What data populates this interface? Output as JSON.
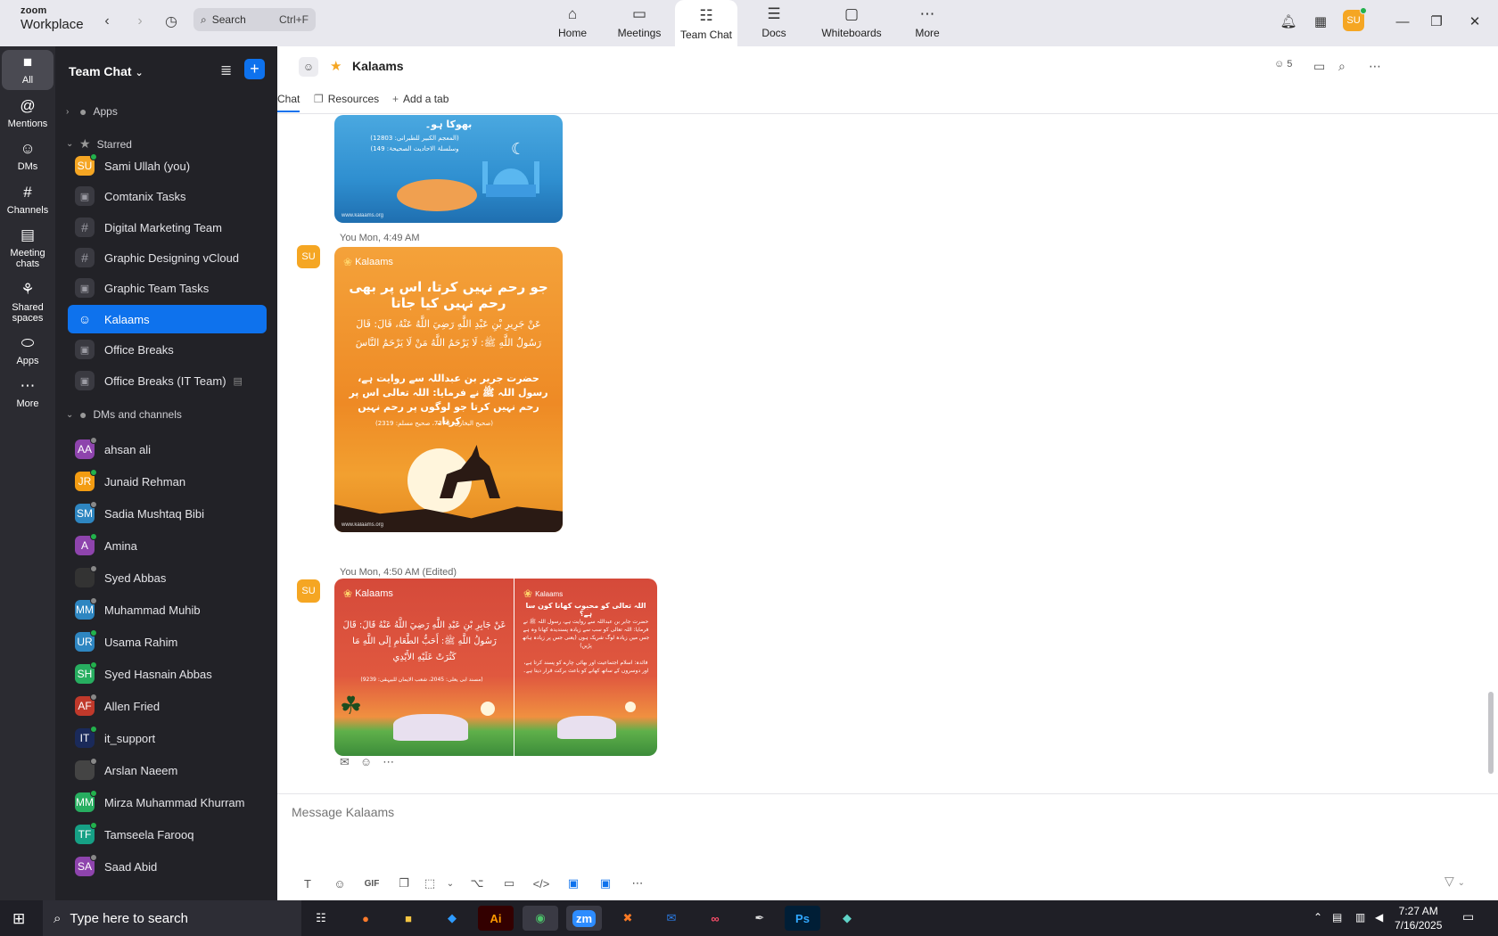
{
  "app": {
    "brand_top": "zoom",
    "brand_bottom": "Workplace"
  },
  "topbar": {
    "search_placeholder": "Search",
    "search_shortcut": "Ctrl+F",
    "tabs": [
      {
        "label": "Home",
        "icon": "home-icon"
      },
      {
        "label": "Meetings",
        "icon": "video-icon"
      },
      {
        "label": "Team Chat",
        "icon": "chat-icon",
        "active": true
      },
      {
        "label": "Docs",
        "icon": "doc-icon"
      },
      {
        "label": "Whiteboards",
        "icon": "whiteboard-icon"
      },
      {
        "label": "More",
        "icon": "more-icon"
      }
    ],
    "user_initials": "SU"
  },
  "rail": [
    {
      "label": "All",
      "icon": "chat-bubble-icon",
      "active": true
    },
    {
      "label": "Mentions",
      "icon": "at-icon"
    },
    {
      "label": "DMs",
      "icon": "people-icon"
    },
    {
      "label": "Channels",
      "icon": "hash-icon"
    },
    {
      "label": "Meeting chats",
      "icon": "calendar-icon"
    },
    {
      "label": "Shared spaces",
      "icon": "shared-icon"
    },
    {
      "label": "Apps",
      "icon": "apps-icon"
    },
    {
      "label": "More",
      "icon": "more-icon"
    }
  ],
  "sidebar": {
    "title": "Team Chat",
    "sections": {
      "apps": "Apps",
      "starred": "Starred",
      "dms": "DMs and channels"
    },
    "starred": [
      {
        "label": "Sami Ullah (you)",
        "type": "avatar",
        "initials": "SU",
        "color": "#f5a623",
        "status": "on"
      },
      {
        "label": "Comtanix Tasks",
        "type": "lock"
      },
      {
        "label": "Digital Marketing Team",
        "type": "hash"
      },
      {
        "label": "Graphic Designing vCloud",
        "type": "hash"
      },
      {
        "label": "Graphic Team Tasks",
        "type": "lock"
      },
      {
        "label": "Kalaams",
        "type": "group",
        "selected": true
      },
      {
        "label": "Office Breaks",
        "type": "lock"
      },
      {
        "label": "Office Breaks (IT Team)",
        "type": "lock",
        "tail": "archive-icon"
      }
    ],
    "dms": [
      {
        "label": "ahsan ali",
        "initials": "AA",
        "color": "#8e44ad",
        "status": "off"
      },
      {
        "label": "Junaid Rehman",
        "initials": "JR",
        "color": "#f39c12",
        "status": "on"
      },
      {
        "label": "Sadia Mushtaq Bibi",
        "initials": "SM",
        "color": "#2e86c1",
        "status": "off"
      },
      {
        "label": "Amina",
        "initials": "A",
        "color": "#8e44ad",
        "status": "on"
      },
      {
        "label": "Syed Abbas",
        "initials": "",
        "color": "#333333",
        "status": "off"
      },
      {
        "label": "Muhammad Muhib",
        "initials": "MM",
        "color": "#2e86c1",
        "status": "off"
      },
      {
        "label": "Usama Rahim",
        "initials": "UR",
        "color": "#2e86c1",
        "status": "on"
      },
      {
        "label": "Syed Hasnain Abbas",
        "initials": "SH",
        "color": "#27ae60",
        "status": "on"
      },
      {
        "label": "Allen Fried",
        "initials": "AF",
        "color": "#c0392b",
        "status": "off"
      },
      {
        "label": "it_support",
        "initials": "IT",
        "color": "#1a2a5a",
        "status": "on"
      },
      {
        "label": "Arslan Naeem",
        "initials": "",
        "color": "#444444",
        "status": "off"
      },
      {
        "label": "Mirza Muhammad Khurram",
        "initials": "MM",
        "color": "#27ae60",
        "status": "on"
      },
      {
        "label": "Tamseela Farooq",
        "initials": "TF",
        "color": "#16a085",
        "status": "on"
      },
      {
        "label": "Saad Abid",
        "initials": "SA",
        "color": "#8e44ad",
        "status": "off"
      }
    ]
  },
  "chat": {
    "title": "Kalaams",
    "member_count": "5",
    "tabs": {
      "chat": "Chat",
      "resources": "Resources",
      "add": "Add a tab"
    },
    "messages": [
      {
        "avatar": "SU",
        "meta": "You Mon, 4:49 AM"
      },
      {
        "avatar": "SU",
        "meta": "You Mon, 4:50 AM (Edited)"
      }
    ],
    "cards": {
      "blue_top_text": "بھوکا ہو۔",
      "blue_ref1": "(المعجم الکبیر للطبرانی: 12803)",
      "blue_ref2": "وسلسلۃ الاحادیث الصحیحۃ: 149)",
      "brand": "Kalaams",
      "orange_title": "جو رحم نہیں کرتا، اس پر بھی رحم نہیں کیا جاتا",
      "orange_arabic": "عَنْ جَرِيرِ بْنِ عَبْدِ اللَّهِ رَضِيَ اللَّهُ عَنْهُ، قَالَ: قَالَ رَسُولُ اللَّهِ ﷺ: لَا يَرْحَمُ اللَّهُ مَنْ لَا يَرْحَمُ النَّاسَ",
      "orange_urdu": "حضرت جریر بن عبداللہ سے روایت ہے، رسول اللہ ﷺ نے فرمایا: اللہ تعالی اس پر رحم نہیں کرتا جو لوگوں پر رحم نہیں کرتا۔",
      "orange_ref": "(صحیح البخاری: 7376، صحیح مسلم: 2319)",
      "red1_arabic": "عَنْ جَابِرِ بْنِ عَبْدِ اللَّهِ رَضِيَ اللَّهُ عَنْهُ قَالَ: قَالَ رَسُولُ اللَّهِ ﷺ: أَحَبُّ الطَّعَامِ إِلَى اللَّهِ مَا كَثُرَتْ عَلَيْهِ الأَيْدِي",
      "red1_ref": "(مسند ابی یعلی: 2045، شعب الایمان للبیہقی: 9239)",
      "red2_title": "اللہ تعالی کو محبوب کھانا کون سا ہے؟",
      "red2_body": "حضرت جابر بن عبداللہ سے روایت ہے، رسول اللہ ﷺ نے فرمایا: اللہ تعالی کو سب سے زیادہ پسندیدہ کھانا وہ ہے جس میں زیادہ لوگ شریک ہوں (یعنی جس پر زیادہ ہاتھ پڑیں)",
      "red2_note": "فائدہ: اسلام اجتماعیت اور بھائی چارے کو پسند کرتا ہے، اور دوسروں کے ساتھ کھانے کو باعث برکت قرار دیتا ہے۔",
      "site": "www.kalaams.org"
    },
    "composer_placeholder": "Message Kalaams",
    "composer_tools": [
      "text-format-icon",
      "emoji-icon",
      "gif-icon",
      "file-icon",
      "screenshot-icon",
      "dropdown-icon",
      "mic-icon",
      "video-message-icon",
      "code-icon",
      "app-blue-icon",
      "app-blue2-icon",
      "more-icon"
    ],
    "gif_label": "GIF"
  },
  "taskbar": {
    "search_placeholder": "Type here to search",
    "apps": [
      "firefox",
      "file-explorer",
      "vscode",
      "illustrator",
      "chrome",
      "zoom",
      "xampp",
      "outlook",
      "creative-cloud",
      "pen-tool",
      "photoshop",
      "app"
    ],
    "ai_label": "Ai",
    "zoom_label": "zm",
    "ps_label": "Ps",
    "time": "7:27 AM",
    "date": "7/16/2025"
  },
  "colors": {
    "accent": "#0e72ed",
    "sidebar_bg": "#222227",
    "rail_bg": "#2b2b31",
    "online": "#22b14c"
  }
}
